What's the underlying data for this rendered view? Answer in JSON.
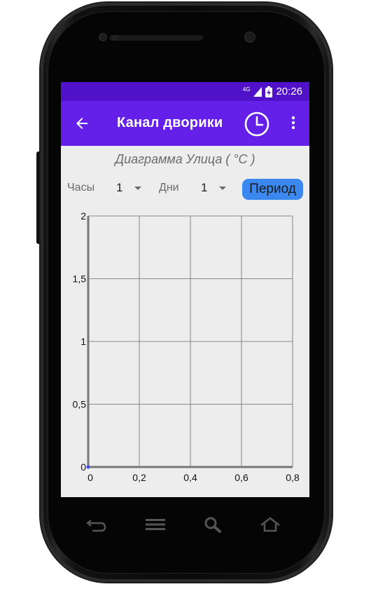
{
  "status_bar": {
    "network": "4G",
    "time": "20:26"
  },
  "app_bar": {
    "back_icon": "arrow-left-icon",
    "title": "Канал дворики",
    "clock_icon": "clock-icon",
    "more_icon": "more-vert-icon"
  },
  "chart_header": {
    "title": "Диаграмма Улица ( °C )"
  },
  "controls": {
    "hours_label": "Часы",
    "hours_value": "1",
    "days_label": "Дни",
    "days_value": "1",
    "period_button": "Период"
  },
  "colors": {
    "status_bar": "#5012c8",
    "app_bar": "#6420e8",
    "button": "#3a88f0",
    "background": "#ededed",
    "point": "#3b4cf0"
  },
  "chart_data": {
    "type": "scatter",
    "xlim": [
      0,
      0.8
    ],
    "ylim": [
      0,
      2
    ],
    "x_ticks": [
      "0",
      "0,2",
      "0,4",
      "0,6",
      "0,8"
    ],
    "y_ticks": [
      "0",
      "0,5",
      "1",
      "1,5",
      "2"
    ],
    "grid": true,
    "series": [
      {
        "points": [
          [
            0,
            0
          ]
        ]
      }
    ]
  },
  "nav_bar": {
    "icons": [
      "back-icon",
      "menu-icon",
      "search-icon",
      "home-icon"
    ]
  }
}
